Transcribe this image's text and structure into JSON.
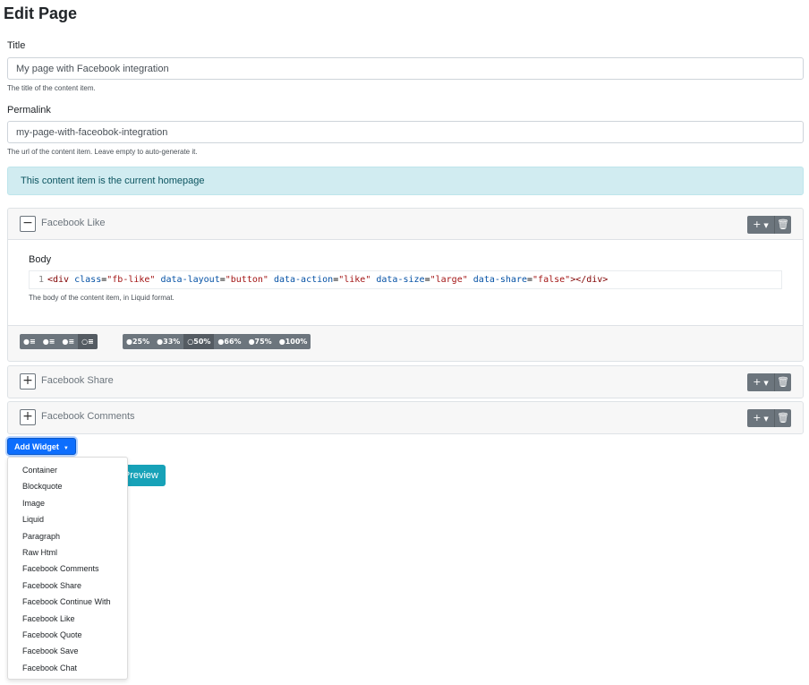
{
  "page": {
    "title": "Edit Page"
  },
  "fields": {
    "title": {
      "label": "Title",
      "value": "My page with Facebook integration",
      "hint": "The title of the content item."
    },
    "permalink": {
      "label": "Permalink",
      "value": "my-page-with-faceobok-integration",
      "hint": "The url of the content item. Leave empty to auto-generate it."
    }
  },
  "alert": {
    "text": "This content item is the current homepage",
    "color": "#d1ecf1"
  },
  "widgets": [
    {
      "title": "Facebook Like",
      "expanded": true,
      "toggle": "−",
      "body": {
        "label": "Body",
        "line_number": "1",
        "code": {
          "open": "<div",
          "class_attr": "class",
          "class_val": "\"fb-like\"",
          "layout_attr": "data-layout",
          "layout_val": "\"button\"",
          "action_attr": "data-action",
          "action_val": "\"like\"",
          "size_attr": "data-size",
          "size_val": "\"large\"",
          "share_attr": "data-share",
          "share_val": "\"false\"",
          "close": "></div>"
        },
        "hint": "The body of the content item, in Liquid format."
      },
      "align_buttons": [
        {
          "icon": "align-left-icon",
          "glyph": "●≡",
          "active": false
        },
        {
          "icon": "align-center-icon",
          "glyph": "●≡",
          "active": false
        },
        {
          "icon": "align-right-icon",
          "glyph": "●≡",
          "active": false
        },
        {
          "icon": "align-justify-icon",
          "glyph": "○≡",
          "active": true
        }
      ],
      "width_buttons": [
        {
          "label": "25%",
          "glyph": "●",
          "active": false
        },
        {
          "label": "33%",
          "glyph": "●",
          "active": false
        },
        {
          "label": "50%",
          "glyph": "○",
          "active": true
        },
        {
          "label": "66%",
          "glyph": "●",
          "active": false
        },
        {
          "label": "75%",
          "glyph": "●",
          "active": false
        },
        {
          "label": "100%",
          "glyph": "●",
          "active": false
        }
      ]
    },
    {
      "title": "Facebook Share",
      "expanded": false,
      "toggle": "+"
    },
    {
      "title": "Facebook Comments",
      "expanded": false,
      "toggle": "+"
    }
  ],
  "tools": {
    "add_glyph": "+",
    "caret_glyph": "▼",
    "delete_glyph": "🗑"
  },
  "actions": {
    "add_widget": "Add Widget",
    "caret": "▼",
    "preview": "Preview"
  },
  "dropdown_items": [
    "Container",
    "Blockquote",
    "Image",
    "Liquid",
    "Paragraph",
    "Raw Html",
    "Facebook Comments",
    "Facebook Share",
    "Facebook Continue With",
    "Facebook Like",
    "Facebook Quote",
    "Facebook Save",
    "Facebook Chat"
  ]
}
